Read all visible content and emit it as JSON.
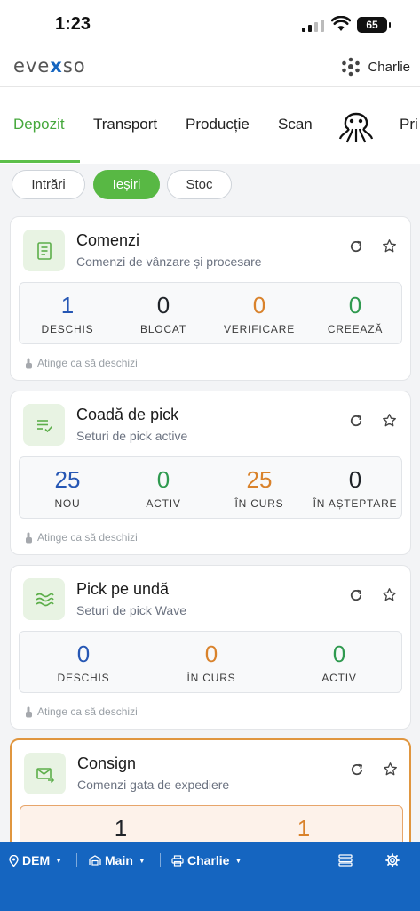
{
  "status": {
    "time": "1:23",
    "battery": "65"
  },
  "header": {
    "logo": {
      "pre": "eve",
      "x": "x",
      "post": "so"
    },
    "user": "Charlie"
  },
  "nav": {
    "tabs": [
      {
        "label": "Depozit"
      },
      {
        "label": "Transport"
      },
      {
        "label": "Producție"
      },
      {
        "label": "Scan"
      },
      {
        "label": "Pri"
      }
    ],
    "icon": "octopus-icon"
  },
  "subtabs": [
    {
      "label": "Intrări"
    },
    {
      "label": "Ieșiri"
    },
    {
      "label": "Stoc"
    }
  ],
  "cards": [
    {
      "title": "Comenzi",
      "subtitle": "Comenzi de vânzare și procesare",
      "icon": "receipt-icon",
      "stats": [
        {
          "value": "1",
          "label": "DESCHIS"
        },
        {
          "value": "0",
          "label": "BLOCAT"
        },
        {
          "value": "0",
          "label": "VERIFICARE"
        },
        {
          "value": "0",
          "label": "CREEAZĂ"
        }
      ],
      "hint": "Atinge ca să deschizi"
    },
    {
      "title": "Coadă de pick",
      "subtitle": "Seturi de pick active",
      "icon": "list-check-icon",
      "stats": [
        {
          "value": "25",
          "label": "NOU"
        },
        {
          "value": "0",
          "label": "ACTIV"
        },
        {
          "value": "25",
          "label": "ÎN CURS"
        },
        {
          "value": "0",
          "label": "ÎN AȘTEPTARE"
        }
      ],
      "hint": "Atinge ca să deschizi"
    },
    {
      "title": "Pick pe undă",
      "subtitle": "Seturi de pick Wave",
      "icon": "wave-icon",
      "stats": [
        {
          "value": "0",
          "label": "DESCHIS"
        },
        {
          "value": "0",
          "label": "ÎN CURS"
        },
        {
          "value": "0",
          "label": "ACTIV"
        }
      ],
      "hint": "Atinge ca să deschizi"
    },
    {
      "title": "Consign",
      "subtitle": "Comenzi gata de expediere",
      "icon": "mail-send-icon",
      "stats": [
        {
          "value": "1",
          "label": ""
        },
        {
          "value": "1",
          "label": ""
        }
      ]
    }
  ],
  "bottom": {
    "location": "DEM",
    "site": "Main",
    "user": "Charlie"
  },
  "colors": {
    "accent_green": "#58b844",
    "bar_blue": "#1565c0",
    "stat_blue": "#2657b4",
    "stat_orange": "#d9822b",
    "stat_green": "#2f9a4f"
  }
}
